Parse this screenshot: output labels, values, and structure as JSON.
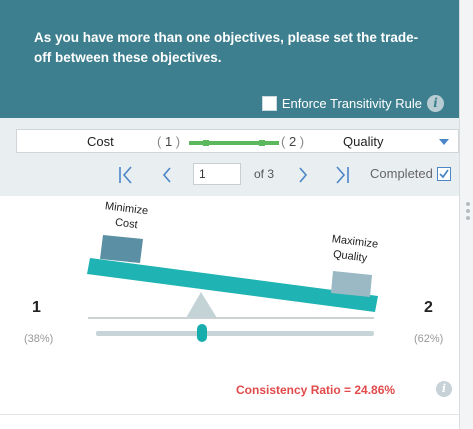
{
  "header": {
    "text": "As you have more than one objectives, please set the trade-off between these objectives.",
    "enforce_label": "Enforce Transitivity Rule"
  },
  "selector": {
    "left_name": "Cost",
    "left_index": "1",
    "right_index": "2",
    "right_name": "Quality"
  },
  "pagination": {
    "current_page": "1",
    "of_label": "of 3",
    "completed_label": "Completed",
    "completed_checked": true
  },
  "balance": {
    "left_box_label_line1": "Minimize",
    "left_box_label_line2": "Cost",
    "right_box_label_line1": "Maximize",
    "right_box_label_line2": "Quality",
    "left_number": "1",
    "right_number": "2",
    "left_percent": "(38%)",
    "right_percent": "(62%)",
    "slider_value_fraction": 0.38
  },
  "consistency": {
    "label": "Consistency Ratio  =  24.86%"
  },
  "icons": {
    "info": "i",
    "nav_first": "first-page-icon",
    "nav_prev": "prev-page-icon",
    "nav_next": "next-page-icon",
    "nav_last": "last-page-icon"
  },
  "colors": {
    "header_bg": "#3d7f8e",
    "beam": "#1fb3b3",
    "accent_blue": "#4a86c8",
    "ratio_red": "#e24a4a",
    "selector_green": "#5cb85c"
  }
}
